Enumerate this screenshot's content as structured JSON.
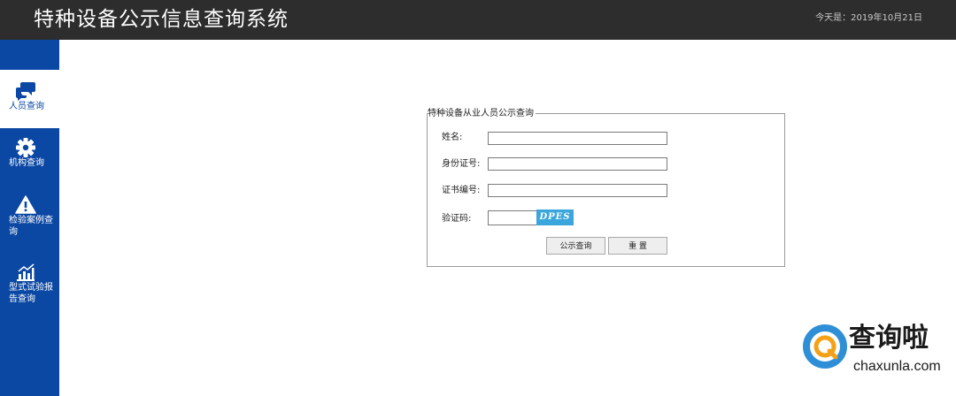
{
  "header": {
    "title": "特种设备公示信息查询系统",
    "date_label": "今天是：",
    "date_value": "2019年10月21日"
  },
  "sidebar": {
    "items": [
      {
        "label": "人员查询",
        "icon": "chat-bubbles-icon",
        "active": true
      },
      {
        "label": "机构查询",
        "icon": "gear-icon",
        "active": false
      },
      {
        "label": "检验案例查询",
        "icon": "warning-icon",
        "active": false
      },
      {
        "label": "型式试验报告查询",
        "icon": "bar-chart-icon",
        "active": false
      }
    ]
  },
  "form": {
    "legend": "特种设备从业人员公示查询",
    "name_label": "姓名:",
    "id_label": "身份证号:",
    "cert_label": "证书编号:",
    "captcha_label": "验证码:",
    "captcha_text": "DPES",
    "query_button": "公示查询",
    "reset_button": "重 置"
  },
  "watermark": {
    "chinese": "查询啦",
    "domain": "chaxunla.com"
  },
  "colors": {
    "header_bg": "#2d2d2d",
    "sidebar_bg": "#0b48a3",
    "captcha_bg": "#3aa6dc",
    "watermark_ring": "#2f8fd6",
    "watermark_q": "#f4a11a"
  }
}
